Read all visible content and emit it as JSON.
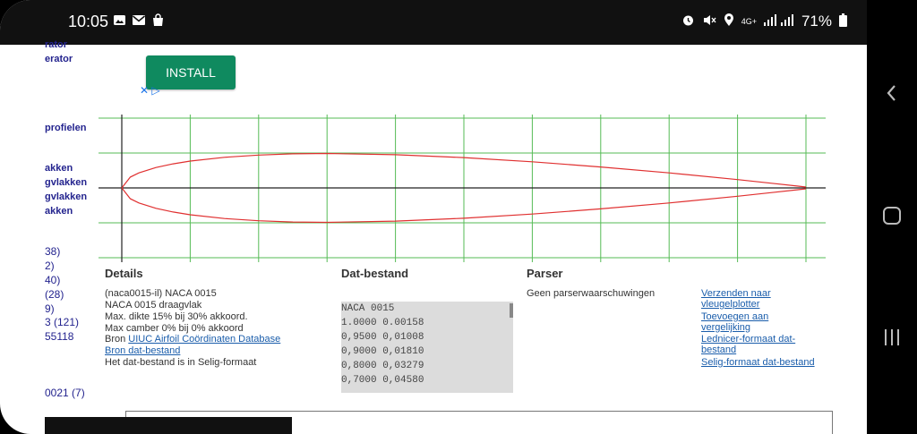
{
  "status_bar": {
    "time": "10:05",
    "left_icons": [
      "image-icon",
      "mail-icon",
      "shopping-bag-icon"
    ],
    "right_icons": [
      "alarm-icon",
      "mute-icon",
      "location-icon"
    ],
    "network": "4G+",
    "battery": "71%"
  },
  "sidebar": {
    "links_top": [
      "rator",
      "erator"
    ],
    "links_mid": [
      "profielen"
    ],
    "links_lower": [
      "akken",
      "gvlakken",
      "gvlakken",
      "akken"
    ],
    "counts": [
      "38)",
      "2)",
      "40)",
      "(28)",
      "9)",
      "3 (121)",
      "55118",
      "0021 (7)"
    ]
  },
  "ad": {
    "install_label": "INSTALL",
    "close_symbol": "✕",
    "adchoices_symbol": "▷"
  },
  "chart_data": {
    "type": "line",
    "title": "",
    "xlabel": "",
    "ylabel": "",
    "xlim": [
      0,
      1
    ],
    "ylim": [
      -0.1,
      0.1
    ],
    "grid": true,
    "series": [
      {
        "x": [
          0,
          0.0125,
          0.025,
          0.05,
          0.075,
          0.1,
          0.15,
          0.2,
          0.25,
          0.3,
          0.4,
          0.5,
          0.6,
          0.7,
          0.8,
          0.9,
          0.95,
          1.0
        ],
        "y": [
          0,
          0.0189,
          0.0262,
          0.0356,
          0.042,
          0.0468,
          0.0534,
          0.0573,
          0.0595,
          0.0601,
          0.058,
          0.0529,
          0.0456,
          0.0366,
          0.0262,
          0.0145,
          0.0081,
          0.0016
        ]
      },
      {
        "x": [
          0,
          0.0125,
          0.025,
          0.05,
          0.075,
          0.1,
          0.15,
          0.2,
          0.25,
          0.3,
          0.4,
          0.5,
          0.6,
          0.7,
          0.8,
          0.9,
          0.95,
          1.0
        ],
        "y": [
          0,
          -0.0189,
          -0.0262,
          -0.0356,
          -0.042,
          -0.0468,
          -0.0534,
          -0.0573,
          -0.0595,
          -0.0601,
          -0.058,
          -0.0529,
          -0.0456,
          -0.0366,
          -0.0262,
          -0.0145,
          -0.0081,
          -0.0016
        ]
      }
    ],
    "line_color": "#e03030",
    "grid_color": "#55bb55"
  },
  "details": {
    "heading": "Details",
    "lines": [
      "(naca0015-il) NACA 0015",
      "NACA 0015 draagvlak",
      "Max. dikte 15% bij 30% akkoord.",
      "Max camber 0% bij 0% akkoord"
    ],
    "source_prefix": "Bron ",
    "source_link": "UIUC Airfoil Coördinaten Database",
    "dat_source_link": "Bron dat-bestand",
    "format_note": "Het dat-bestand is in Selig-formaat"
  },
  "dat_file": {
    "heading": "Dat-bestand",
    "rows": [
      "NACA 0015",
      "1.0000 0.00158",
      "0,9500 0,01008",
      "0,9000 0,01810",
      "0,8000 0,03279",
      "0,7000 0,04580"
    ]
  },
  "parser": {
    "heading": "Parser",
    "message": "Geen parserwaarschuwingen",
    "actions": [
      [
        "Verzenden naar",
        "vleugelplotter"
      ],
      [
        "Toevoegen aan",
        "vergelijking"
      ],
      [
        "Lednicer-formaat dat-",
        "bestand"
      ],
      [
        "Selig-formaat dat-bestand"
      ]
    ]
  }
}
